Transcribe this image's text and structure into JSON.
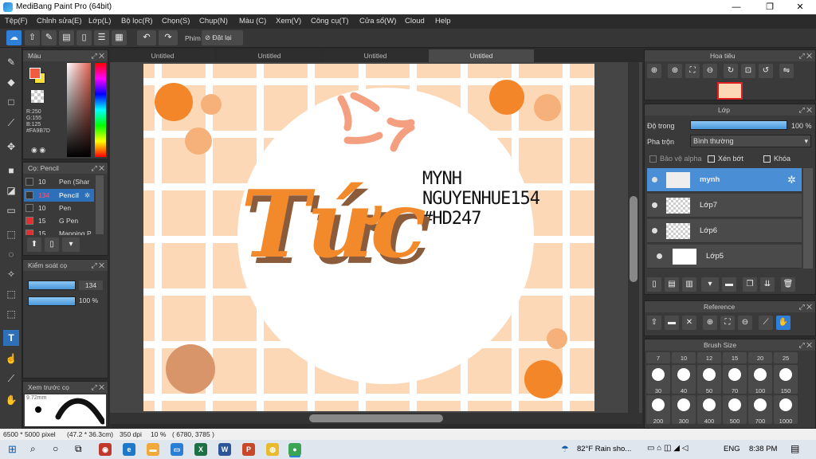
{
  "window": {
    "title": "MediBang Paint Pro (64bit)",
    "minimize": "—",
    "maximize": "❐",
    "close": "✕"
  },
  "menu": [
    "Tệp(F)",
    "Chỉnh sửa(E)",
    "Lớp(L)",
    "Bộ lọc(R)",
    "Chọn(S)",
    "Chụp(N)",
    "Màu (C)",
    "Xem(V)",
    "Công cụ(T)",
    "Cửa sổ(W)",
    "Cloud",
    "Help"
  ],
  "toolbar": {
    "key_label": "Phím",
    "reset_label": "Đặt lại"
  },
  "tabs": [
    "Untitled",
    "Untitled",
    "Untitled",
    "Untitled"
  ],
  "color_panel": {
    "title": "Màu",
    "rgb": [
      "R:250",
      "G:155",
      "B:125",
      "#FA9B7D"
    ],
    "fg_color": "#f15b41",
    "bg_color": "#f7e03a"
  },
  "brush_panel": {
    "title": "Cọ: Pencil",
    "brushes": [
      {
        "size": "10",
        "name": "Pen (Shar",
        "color": "#333333"
      },
      {
        "size": "134",
        "name": "Pencil",
        "color": "#333333"
      },
      {
        "size": "10",
        "name": "Pen",
        "color": "#333333"
      },
      {
        "size": "15",
        "name": "G Pen",
        "color": "#e03030"
      },
      {
        "size": "15",
        "name": "Mapping P",
        "color": "#e03030"
      }
    ]
  },
  "brush_control": {
    "title": "Kiểm soát cọ",
    "size": "134",
    "opacity": "100 %"
  },
  "preview_panel": {
    "title": "Xem trước cọ",
    "size": "9.72mm"
  },
  "canvas_text": {
    "line1": "MYNH",
    "line2": "NGUYENHUE154",
    "line3": "#HD247",
    "word": "Tức"
  },
  "navigator": {
    "title": "Hoa tiêu"
  },
  "layer_panel": {
    "title": "Lớp",
    "opacity_label": "Độ trong",
    "opacity_value": "100 %",
    "blend_label": "Pha trộn",
    "blend_value": "Bình thường",
    "protect_alpha": "Bảo vệ alpha",
    "clip": "Xén bớt",
    "lock": "Khóa",
    "layers": [
      "mynh",
      "Lớp7",
      "Lớp6",
      "Lớp5"
    ]
  },
  "reference": {
    "title": "Reference"
  },
  "brush_size": {
    "title": "Brush Size",
    "row1": [
      "7",
      "10",
      "12",
      "15",
      "20",
      "25"
    ],
    "row2": [
      "30",
      "40",
      "50",
      "70",
      "100",
      "150"
    ],
    "row3": [
      "200",
      "300",
      "400",
      "500",
      "700",
      "1000"
    ]
  },
  "status": {
    "dimensions": "6500 * 5000 pixel",
    "size_mm": "(47.2 * 36.3cm)",
    "dpi": "350 dpi",
    "zoom": "10 %",
    "coords": "( 6780, 3785 )"
  },
  "taskbar": {
    "weather": "82°F  Rain sho...",
    "lang": "ENG",
    "time": "8:38 PM"
  }
}
